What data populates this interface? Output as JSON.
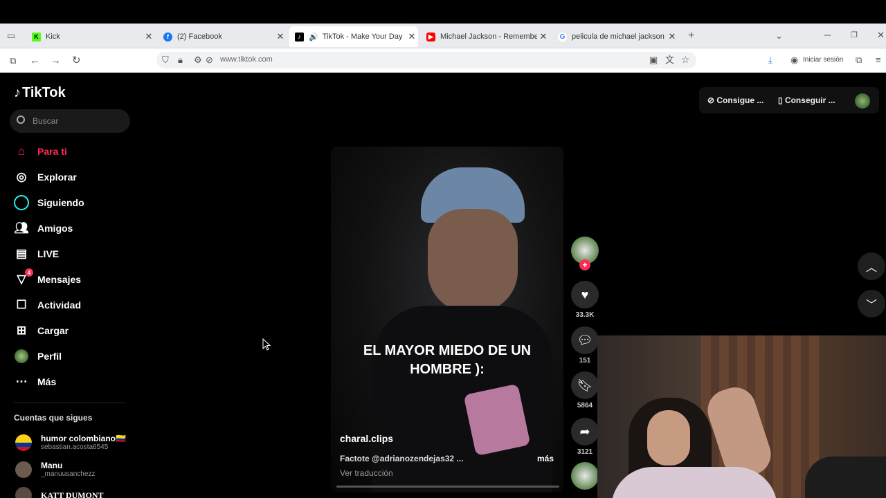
{
  "browser": {
    "tabs": [
      {
        "title": "Kick",
        "favicon": "kick-icon",
        "color": "#53fc18",
        "active": false
      },
      {
        "title": "(2) Facebook",
        "favicon": "facebook-icon",
        "color": "#1877f2",
        "active": false
      },
      {
        "title": "TikTok - Make Your Day",
        "favicon": "tiktok-icon",
        "color": "#000000",
        "active": true
      },
      {
        "title": "Michael Jackson - Remember th",
        "favicon": "youtube-icon",
        "color": "#ff0000",
        "active": false
      },
      {
        "title": "pelicula de michael jackson - Bu",
        "favicon": "google-icon",
        "color": "#4285f4",
        "active": false
      }
    ],
    "url": "www.tiktok.com",
    "login_label": "Iniciar sesión"
  },
  "sidebar": {
    "logo_text": "TikTok",
    "search_placeholder": "Buscar",
    "nav": [
      {
        "label": "Para ti",
        "icon": "home-icon",
        "active": true
      },
      {
        "label": "Explorar",
        "icon": "compass-icon",
        "active": false
      },
      {
        "label": "Siguiendo",
        "icon": "following-icon",
        "active": false
      },
      {
        "label": "Amigos",
        "icon": "friends-icon",
        "active": false
      },
      {
        "label": "LIVE",
        "icon": "live-icon",
        "active": false
      },
      {
        "label": "Mensajes",
        "icon": "messages-icon",
        "active": false,
        "badge": "4"
      },
      {
        "label": "Actividad",
        "icon": "activity-icon",
        "active": false
      },
      {
        "label": "Cargar",
        "icon": "upload-icon",
        "active": false
      },
      {
        "label": "Perfil",
        "icon": "profile-icon",
        "active": false
      },
      {
        "label": "Más",
        "icon": "more-icon",
        "active": false
      }
    ],
    "following_heading": "Cuentas que sigues",
    "accounts": [
      {
        "name": "humor colombiano🇨🇴",
        "handle": "sebastian.acosta6545"
      },
      {
        "name": "Manu",
        "handle": "_manuusanchezz"
      },
      {
        "name": "KATT DUMONT",
        "handle": ""
      }
    ]
  },
  "header": {
    "get_coins_label": "Consigue ...",
    "get_app_label": "Conseguir ..."
  },
  "video": {
    "caption": "EL MAYOR MIEDO DE UN HOMBRE ):",
    "author": "charal.clips",
    "description": "Factote @adrianozendejas32 ...",
    "more_label": "más",
    "translate_label": "Ver traducción",
    "likes": "33.3K",
    "comments": "151",
    "saves": "5864",
    "shares": "3121"
  },
  "colors": {
    "accent": "#fe2c55",
    "background": "#000000"
  }
}
